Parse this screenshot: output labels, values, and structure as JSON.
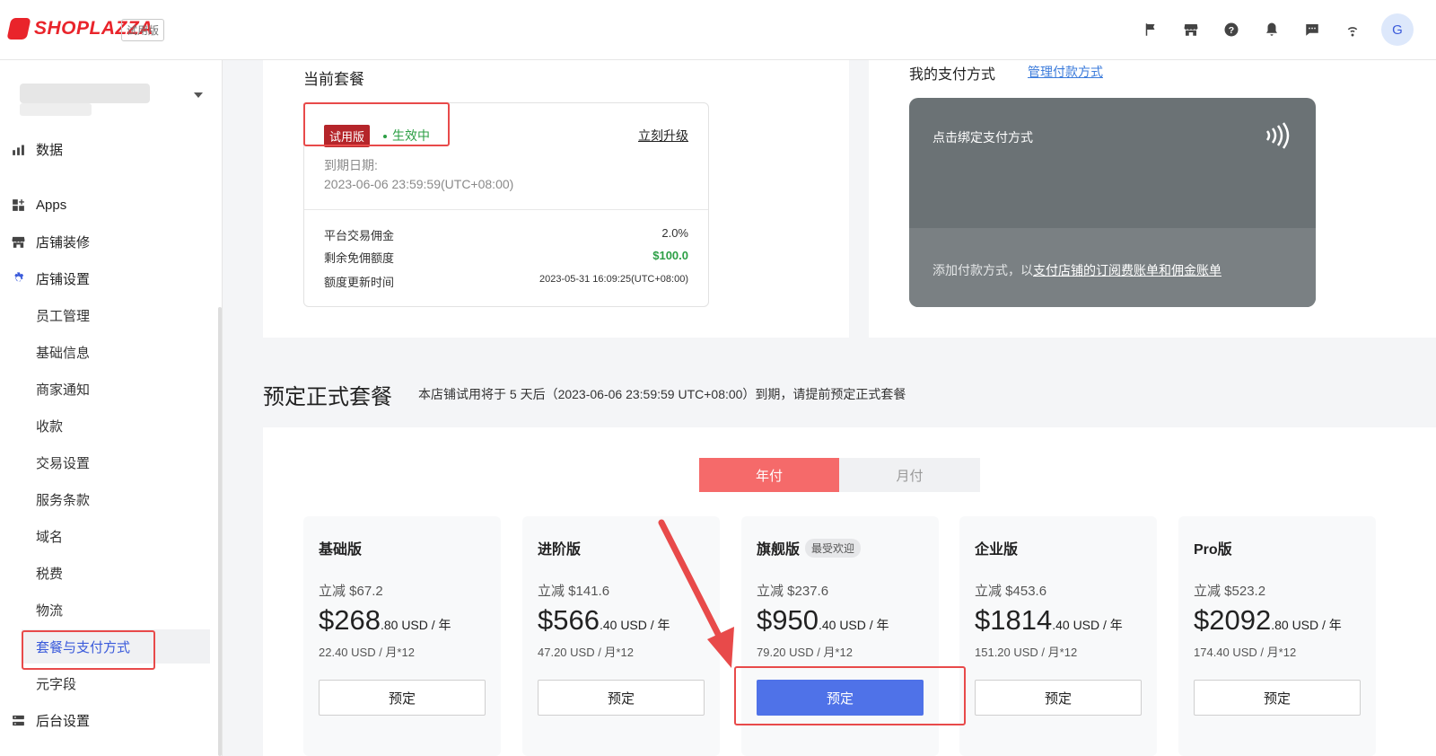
{
  "header": {
    "logo_text": "SHOPLAZZA",
    "trial_tag": "试用版",
    "icons": [
      "flag-icon",
      "store-icon",
      "help-icon",
      "bell-icon",
      "message-icon",
      "wifi-icon"
    ],
    "avatar_initial": "G"
  },
  "sidebar": {
    "items": [
      {
        "label": "数据",
        "icon": "bar-chart-icon"
      },
      {
        "label": "Apps",
        "icon": "apps-icon"
      },
      {
        "label": "店铺装修",
        "icon": "storefront-icon"
      },
      {
        "label": "店铺设置",
        "icon": "settings-gear-icon"
      }
    ],
    "sub_items": [
      "员工管理",
      "基础信息",
      "商家通知",
      "收款",
      "交易设置",
      "服务条款",
      "域名",
      "税费",
      "物流",
      "套餐与支付方式",
      "元字段"
    ],
    "bottom_item": {
      "label": "后台设置",
      "icon": "admin-settings-icon"
    }
  },
  "current_plan": {
    "title": "当前套餐",
    "badge": "试用版",
    "status": "生效中",
    "upgrade_label": "立刻升级",
    "expiry_label": "到期日期:",
    "expiry_value": "2023-06-06 23:59:59(UTC+08:00)",
    "rows": [
      {
        "label": "平台交易佣金",
        "value": "2.0%"
      },
      {
        "label": "剩余免佣额度",
        "value": "$100.0"
      },
      {
        "label": "额度更新时间",
        "value": "2023-05-31 16:09:25(UTC+08:00)"
      }
    ]
  },
  "payment": {
    "title": "我的支付方式",
    "manage_link": "管理付款方式",
    "card_title": "点击绑定支付方式",
    "card_hint_prefix": "添加付款方式，以",
    "card_hint_link": "支付店铺的订阅费账单和佣金账单"
  },
  "booking": {
    "title": "预定正式套餐",
    "subtitle": "本店铺试用将于 5 天后（2023-06-06 23:59:59 UTC+08:00）到期，请提前预定正式套餐",
    "toggle_yearly": "年付",
    "toggle_monthly": "月付",
    "tiers": [
      {
        "name": "基础版",
        "tag": "",
        "discount": "立减 $67.2",
        "price_main": "$268",
        "price_rest": ".80 USD / 年",
        "monthly": "22.40   USD / 月*12",
        "button": "预定"
      },
      {
        "name": "进阶版",
        "tag": "",
        "discount": "立减 $141.6",
        "price_main": "$566",
        "price_rest": ".40 USD / 年",
        "monthly": "47.20   USD / 月*12",
        "button": "预定"
      },
      {
        "name": "旗舰版",
        "tag": "最受欢迎",
        "discount": "立减 $237.6",
        "price_main": "$950",
        "price_rest": ".40 USD / 年",
        "monthly": "79.20   USD / 月*12",
        "button": "预定"
      },
      {
        "name": "企业版",
        "tag": "",
        "discount": "立减 $453.6",
        "price_main": "$1814",
        "price_rest": ".40 USD / 年",
        "monthly": "151.20   USD / 月*12",
        "button": "预定"
      },
      {
        "name": "Pro版",
        "tag": "",
        "discount": "立减 $523.2",
        "price_main": "$2092",
        "price_rest": ".80 USD / 年",
        "monthly": "174.40   USD / 月*12",
        "button": "预定"
      }
    ]
  },
  "colors": {
    "brand_red": "#e9242b",
    "accent_blue": "#4f72e8",
    "status_green": "#2c9f45",
    "highlight_red": "#e84a4a",
    "toggle_active": "#f56a6a"
  }
}
